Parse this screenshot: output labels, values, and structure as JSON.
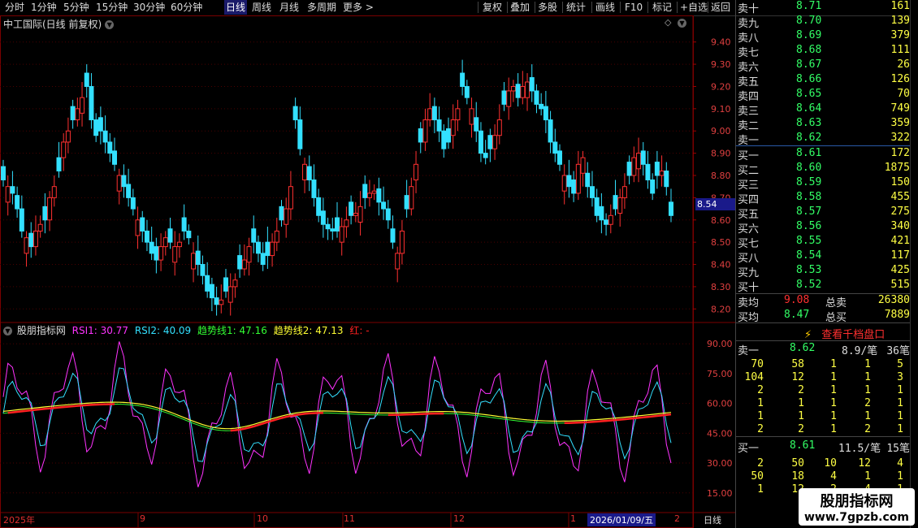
{
  "toolbar": {
    "periods": [
      "分时",
      "1分钟",
      "5分钟",
      "15分钟",
      "30分钟",
      "60分钟",
      "日线",
      "周线",
      "月线",
      "多周期",
      "更多 >"
    ],
    "active_period": "日线",
    "tools": [
      "复权",
      "叠加",
      "多股",
      "统计",
      "画线",
      "F10",
      "标记",
      "+自选",
      "返回"
    ]
  },
  "main_chart": {
    "title": "中工国际(日线 前复权)",
    "price_axis": [
      "9.40",
      "9.30",
      "9.20",
      "9.10",
      "9.00",
      "8.90",
      "8.80",
      "8.70",
      "8.60",
      "8.50",
      "8.40",
      "8.30",
      "8.20"
    ],
    "current_price_tag": "8.54",
    "colors": {
      "up": "#ff3030",
      "down": "#33e0ff",
      "grid": "#5a0000",
      "axis_text": "#e04040"
    }
  },
  "indicator": {
    "name": "股朋指标网",
    "rsi1_label": "RSI1: 30.77",
    "rsi2_label": "RSI2: 40.09",
    "trend1_label": "趋势线1: 47.16",
    "trend2_label": "趋势线2: 47.13",
    "red_label": "红: -",
    "axis": [
      "90.00",
      "75.00",
      "60.00",
      "45.00",
      "30.00",
      "15.00"
    ],
    "colors": {
      "rsi1": "#ff33ff",
      "rsi2": "#33e0ff",
      "trend1": "#ffff33",
      "trend2": "#33ff33",
      "red": "#ff2020"
    }
  },
  "x_axis": {
    "labels": [
      "2025年",
      "9",
      "10",
      "11",
      "12",
      "1",
      "2026/01/09/五",
      "2"
    ],
    "period_label": "日线"
  },
  "order_book": {
    "asks": [
      {
        "label": "卖十",
        "price": "8.71",
        "vol": "161"
      },
      {
        "label": "卖九",
        "price": "8.70",
        "vol": "139"
      },
      {
        "label": "卖八",
        "price": "8.69",
        "vol": "379"
      },
      {
        "label": "卖七",
        "price": "8.68",
        "vol": "111"
      },
      {
        "label": "卖六",
        "price": "8.67",
        "vol": "26"
      },
      {
        "label": "卖五",
        "price": "8.66",
        "vol": "126"
      },
      {
        "label": "卖四",
        "price": "8.65",
        "vol": "70"
      },
      {
        "label": "卖三",
        "price": "8.64",
        "vol": "749"
      },
      {
        "label": "卖二",
        "price": "8.63",
        "vol": "359"
      },
      {
        "label": "卖一",
        "price": "8.62",
        "vol": "322"
      }
    ],
    "bids": [
      {
        "label": "买一",
        "price": "8.61",
        "vol": "172"
      },
      {
        "label": "买二",
        "price": "8.60",
        "vol": "1875"
      },
      {
        "label": "买三",
        "price": "8.59",
        "vol": "150"
      },
      {
        "label": "买四",
        "price": "8.58",
        "vol": "455"
      },
      {
        "label": "买五",
        "price": "8.57",
        "vol": "275"
      },
      {
        "label": "买六",
        "price": "8.56",
        "vol": "340"
      },
      {
        "label": "买七",
        "price": "8.55",
        "vol": "421"
      },
      {
        "label": "买八",
        "price": "8.54",
        "vol": "117"
      },
      {
        "label": "买九",
        "price": "8.53",
        "vol": "425"
      },
      {
        "label": "买十",
        "price": "8.52",
        "vol": "515"
      }
    ],
    "avg_sell_label": "卖均",
    "avg_sell": "9.08",
    "total_sell_label": "总卖",
    "total_sell": "26380",
    "avg_buy_label": "买均",
    "avg_buy": "8.47",
    "total_buy_label": "总买",
    "total_buy": "7889",
    "view_thousand": "查看千档盘口",
    "ask1_row": {
      "label": "卖一",
      "price": "8.62",
      "per": "8.9/笔",
      "count": "36笔"
    },
    "ask1_grid": [
      [
        "70",
        "58",
        "1",
        "1",
        "5"
      ],
      [
        "104",
        "12",
        "1",
        "1",
        "3"
      ],
      [
        "2",
        "2",
        "1",
        "1",
        "1"
      ],
      [
        "1",
        "1",
        "1",
        "2",
        "1"
      ],
      [
        "1",
        "1",
        "1",
        "1",
        "1"
      ],
      [
        "2",
        "2",
        "1",
        "2",
        "1"
      ]
    ],
    "bid1_row": {
      "label": "买一",
      "price": "8.61",
      "per": "11.5/笔",
      "count": "15笔"
    },
    "bid1_grid": [
      [
        "2",
        "50",
        "10",
        "12",
        "4"
      ],
      [
        "50",
        "18",
        "4",
        "1",
        "1"
      ],
      [
        "1",
        "12",
        "2",
        "4",
        "1"
      ]
    ]
  },
  "watermark": {
    "line1": "股朋指标网",
    "line2": "www.7gpzb.com"
  }
}
